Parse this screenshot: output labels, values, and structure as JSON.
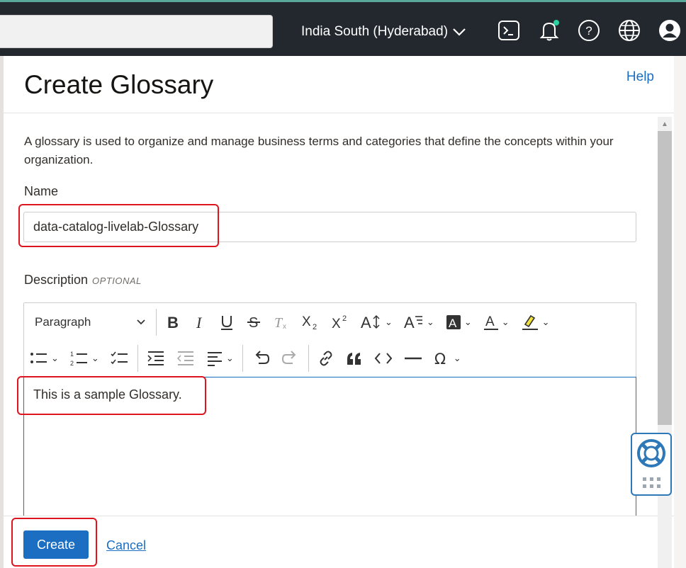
{
  "header": {
    "region_label": "India South (Hyderabad)",
    "icons": [
      "terminal-icon",
      "bell-icon",
      "help-circle-icon",
      "globe-icon",
      "profile-icon"
    ],
    "notification_dot_color": "#2bd1a5",
    "background_color": "#22282e"
  },
  "panel": {
    "title": "Create Glossary",
    "help_label": "Help",
    "intro": "A glossary is used to organize and manage business terms and categories that define the concepts within your organization.",
    "name_label": "Name",
    "name_value": "data-catalog-livelab-Glossary",
    "description_label": "Description",
    "optional_tag": "OPTIONAL",
    "description_value": "This is a sample Glossary."
  },
  "editor_toolbar": {
    "paragraph_select": "Paragraph",
    "row1": [
      "bold-icon",
      "italic-icon",
      "underline-icon",
      "strikethrough-icon",
      "remove-format-icon",
      "subscript-icon",
      "superscript-icon",
      "font-size-icon",
      "font-family-icon",
      "font-background-color-icon",
      "font-color-icon",
      "highlight-icon"
    ],
    "row2": [
      "bulleted-list-icon",
      "numbered-list-icon",
      "todo-list-icon",
      "indent-icon",
      "outdent-icon",
      "alignment-icon",
      "undo-icon",
      "redo-icon",
      "link-icon",
      "blockquote-icon",
      "code-icon",
      "horizontal-line-icon",
      "special-characters-icon"
    ]
  },
  "footer": {
    "create_label": "Create",
    "cancel_label": "Cancel"
  },
  "colors": {
    "accent": "#1b6ec2",
    "highlight_box": "#e0141f"
  }
}
